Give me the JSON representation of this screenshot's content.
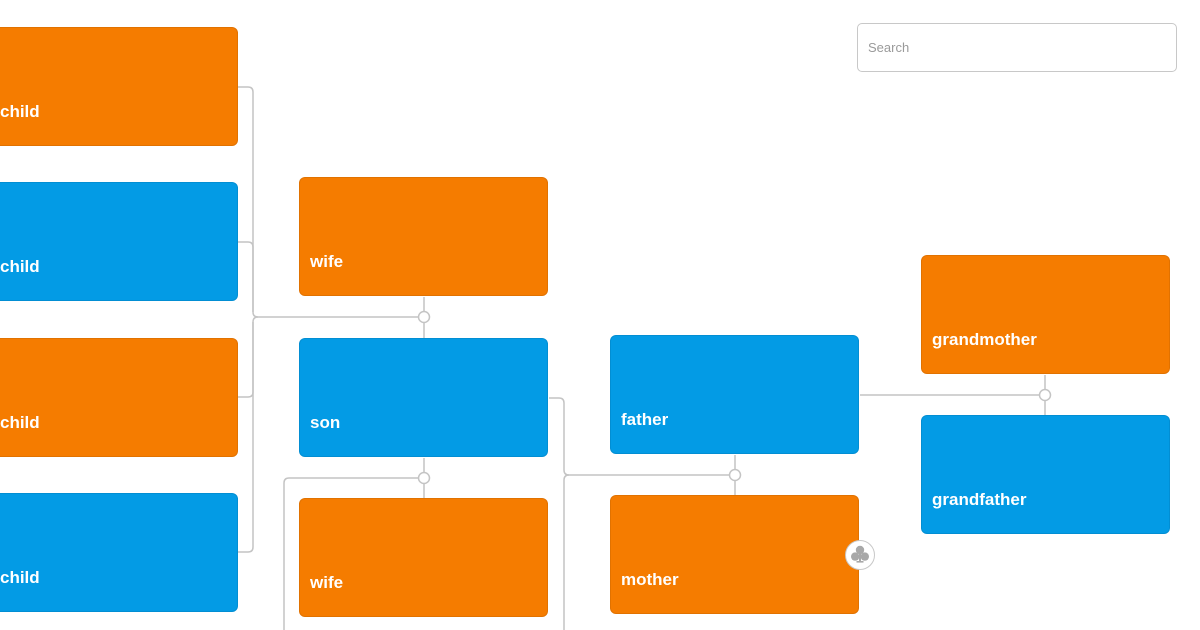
{
  "search": {
    "placeholder": "Search",
    "value": ""
  },
  "colors": {
    "female": "#f57c00",
    "male": "#039be5",
    "link": "#c4c4c4"
  },
  "nodes": [
    {
      "id": "child1",
      "label": "child",
      "gender": "female"
    },
    {
      "id": "child2",
      "label": "child",
      "gender": "male"
    },
    {
      "id": "child3",
      "label": "child",
      "gender": "female"
    },
    {
      "id": "child4",
      "label": "child",
      "gender": "male"
    },
    {
      "id": "wife1",
      "label": "wife",
      "gender": "female"
    },
    {
      "id": "son",
      "label": "son",
      "gender": "male"
    },
    {
      "id": "wife2",
      "label": "wife",
      "gender": "female"
    },
    {
      "id": "father",
      "label": "father",
      "gender": "male"
    },
    {
      "id": "mother",
      "label": "mother",
      "gender": "female"
    },
    {
      "id": "grandmother",
      "label": "grandmother",
      "gender": "female"
    },
    {
      "id": "grandfather",
      "label": "grandfather",
      "gender": "male"
    }
  ],
  "couples": [
    {
      "partners": [
        "wife1",
        "son"
      ],
      "children": [
        "child1",
        "child2",
        "child3",
        "child4"
      ]
    },
    {
      "partners": [
        "son",
        "wife2"
      ],
      "children": []
    },
    {
      "partners": [
        "father",
        "mother"
      ],
      "children": [
        "son"
      ]
    },
    {
      "partners": [
        "grandmother",
        "grandfather"
      ],
      "children": [
        "father"
      ]
    }
  ],
  "subtree_toggle": {
    "icon": "club-tree-icon",
    "node": "mother"
  }
}
